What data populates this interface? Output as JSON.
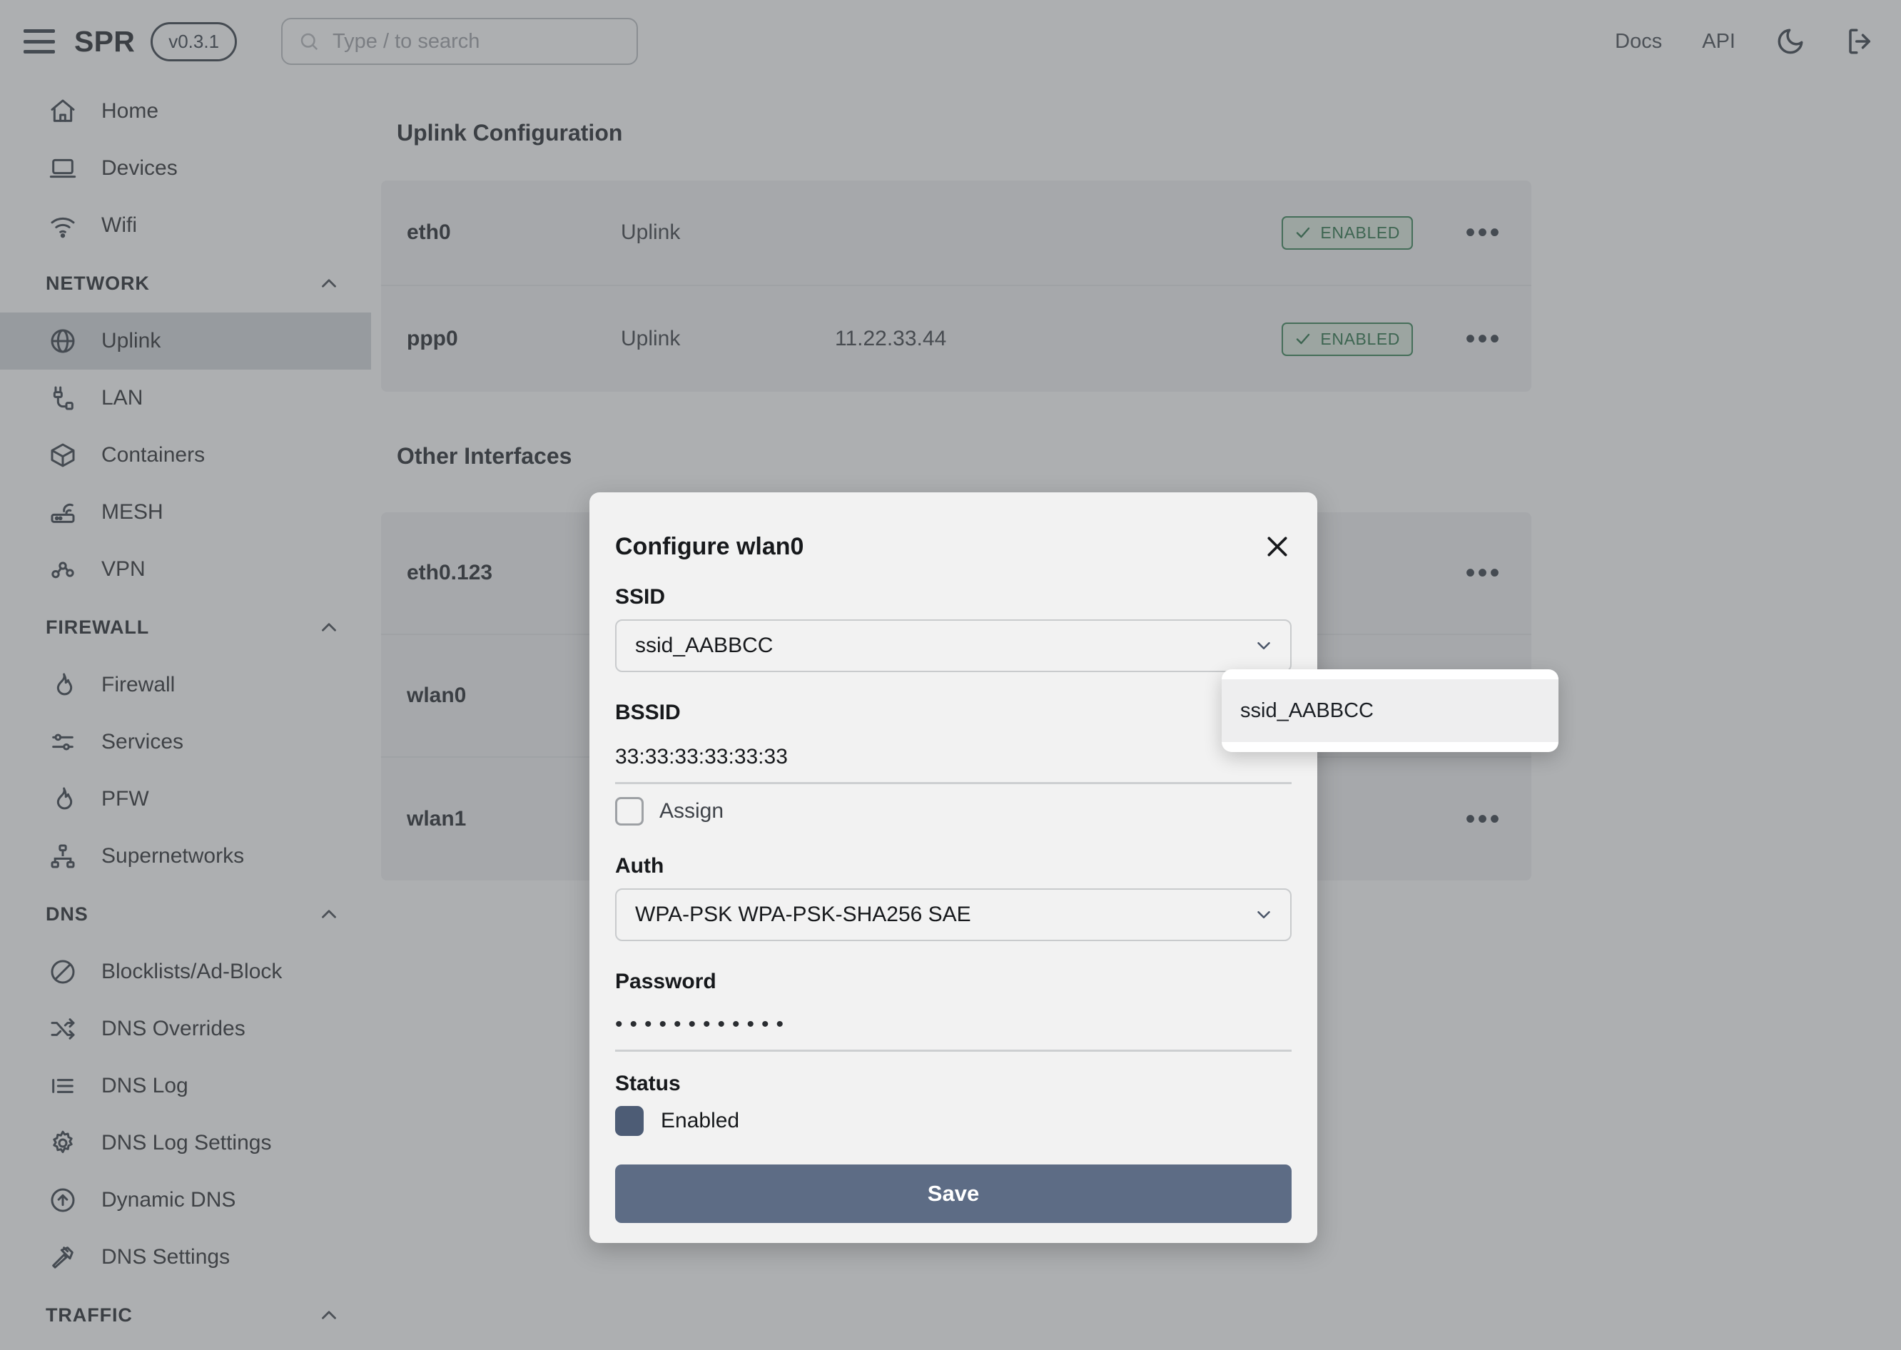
{
  "header": {
    "menu_icon": "hamburger-icon",
    "brand": "SPR",
    "version": "v0.3.1",
    "search_placeholder": "Type / to search",
    "search_icon": "search-icon",
    "docs": "Docs",
    "api": "API",
    "theme_icon": "moon-icon",
    "logout_icon": "logout-icon"
  },
  "sidebar": {
    "top_items": [
      {
        "label": "Home",
        "icon": "home-icon"
      },
      {
        "label": "Devices",
        "icon": "laptop-icon"
      },
      {
        "label": "Wifi",
        "icon": "wifi-icon"
      }
    ],
    "groups": [
      {
        "title": "NETWORK",
        "items": [
          {
            "label": "Uplink",
            "icon": "globe-icon",
            "active": true
          },
          {
            "label": "LAN",
            "icon": "plug-icon",
            "active": false
          },
          {
            "label": "Containers",
            "icon": "box-icon",
            "active": false
          },
          {
            "label": "MESH",
            "icon": "router-icon",
            "active": false
          },
          {
            "label": "VPN",
            "icon": "nodes-icon",
            "active": false
          }
        ]
      },
      {
        "title": "FIREWALL",
        "items": [
          {
            "label": "Firewall",
            "icon": "flame-icon",
            "active": false
          },
          {
            "label": "Services",
            "icon": "sliders-icon",
            "active": false
          },
          {
            "label": "PFW",
            "icon": "flame-icon",
            "active": false
          },
          {
            "label": "Supernetworks",
            "icon": "sitemap-icon",
            "active": false
          }
        ]
      },
      {
        "title": "DNS",
        "items": [
          {
            "label": "Blocklists/Ad-Block",
            "icon": "block-icon",
            "active": false
          },
          {
            "label": "DNS Overrides",
            "icon": "shuffle-icon",
            "active": false
          },
          {
            "label": "DNS Log",
            "icon": "list-icon",
            "active": false
          },
          {
            "label": "DNS Log Settings",
            "icon": "gear-icon",
            "active": false
          },
          {
            "label": "Dynamic DNS",
            "icon": "arrow-up-circle-icon",
            "active": false
          },
          {
            "label": "DNS Settings",
            "icon": "hammer-icon",
            "active": false
          }
        ]
      },
      {
        "title": "TRAFFIC",
        "items": []
      }
    ],
    "collapse_icon": "chevron-up-icon"
  },
  "main": {
    "uplink_section_title": "Uplink Configuration",
    "other_section_title": "Other Interfaces",
    "uplink_rows": [
      {
        "name": "eth0",
        "type": "Uplink",
        "address": "",
        "status": "ENABLED",
        "menu_icon": "kebab-icon"
      },
      {
        "name": "ppp0",
        "type": "Uplink",
        "address": "11.22.33.44",
        "status": "ENABLED",
        "menu_icon": "kebab-icon"
      }
    ],
    "other_rows": [
      {
        "name": "eth0.123",
        "type": "",
        "address": "",
        "menu_icon": "kebab-icon"
      },
      {
        "name": "wlan0",
        "type": "",
        "address": "",
        "menu_icon": "kebab-icon"
      },
      {
        "name": "wlan1",
        "type": "",
        "address": "",
        "menu_icon": "kebab-icon"
      }
    ],
    "status_check_icon": "check-icon"
  },
  "modal": {
    "title": "Configure wlan0",
    "close_icon": "close-icon",
    "ssid_label": "SSID",
    "ssid_value": "ssid_AABBCC",
    "bssid_label": "BSSID",
    "bssid_value": "33:33:33:33:33:33",
    "assign_label": "Assign",
    "auth_label": "Auth",
    "auth_value": "WPA-PSK WPA-PSK-SHA256 SAE",
    "password_label": "Password",
    "password_value": "••••••••••••",
    "status_label": "Status",
    "enabled_label": "Enabled",
    "save_label": "Save",
    "chevron_icon": "chevron-down-icon"
  },
  "dropdown": {
    "options": [
      "ssid_AABBCC"
    ]
  },
  "colors": {
    "accent": "#5d6c85",
    "toggle_on": "#4d5c75",
    "status_green": "#1f6b3f",
    "sidebar_active": "#d3d6da"
  }
}
